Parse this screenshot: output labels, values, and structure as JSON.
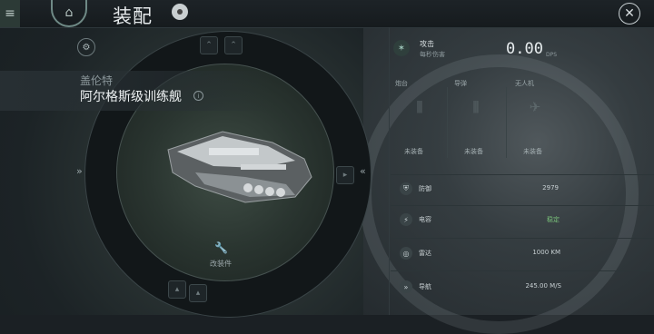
{
  "header": {
    "title": "装配",
    "menu_icon": "hamburger-menu-icon",
    "close_icon": "close-icon"
  },
  "ship": {
    "faction": "盖伦特",
    "name": "阿尔格斯级训练舰",
    "rig_label": "改装件"
  },
  "attack": {
    "label": "攻击",
    "sub_label": "每秒伤害",
    "value": "0.00",
    "unit": "DPS"
  },
  "weapons": [
    {
      "label": "炮台",
      "status": "未装备"
    },
    {
      "label": "导弹",
      "status": "未装备"
    },
    {
      "label": "无人机",
      "status": "未装备"
    }
  ],
  "stats": [
    {
      "label": "防御",
      "value": "2979",
      "icon": "shield-icon"
    },
    {
      "label": "电容",
      "value": "稳定",
      "icon": "capacitor-icon"
    },
    {
      "label": "雷达",
      "value": "1000 KM",
      "icon": "radar-icon"
    },
    {
      "label": "导航",
      "value": "245.00 M/S",
      "icon": "navigation-icon"
    }
  ],
  "colors": {
    "accent_green": "#79c27a",
    "background": "#1b2024"
  }
}
